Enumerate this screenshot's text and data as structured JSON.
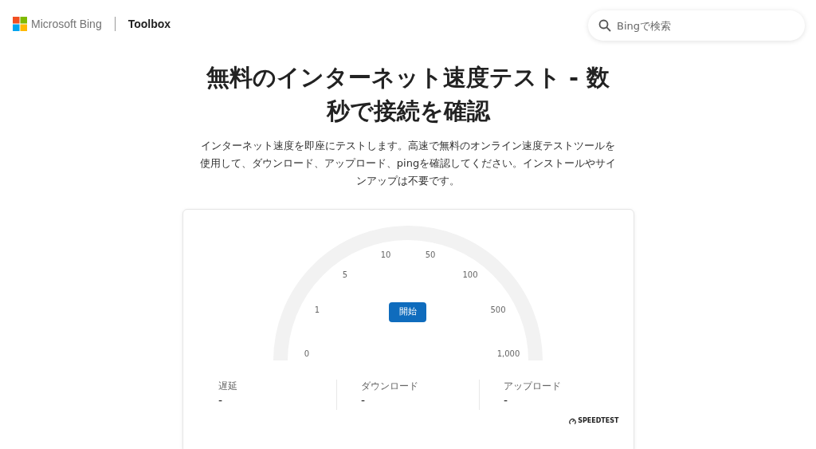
{
  "header": {
    "brand": "Microsoft Bing",
    "section": "Toolbox",
    "search": {
      "placeholder": "Bingで検索"
    }
  },
  "title": "無料のインターネット速度テスト - 数秒で接続を確認",
  "description": "インターネット速度を即座にテストします。高速で無料のオンライン速度テストツールを使用して、ダウンロード、アップロード、pingを確認してください。インストールやサインアップは不要です。",
  "gauge": {
    "ticks": [
      "0",
      "1",
      "5",
      "10",
      "50",
      "100",
      "500",
      "1,000"
    ],
    "start_button": "開始"
  },
  "metrics": [
    {
      "label": "遅延",
      "value": "-"
    },
    {
      "label": "ダウンロード",
      "value": "-"
    },
    {
      "label": "アップロード",
      "value": "-"
    }
  ],
  "provider": "SPEEDTEST"
}
